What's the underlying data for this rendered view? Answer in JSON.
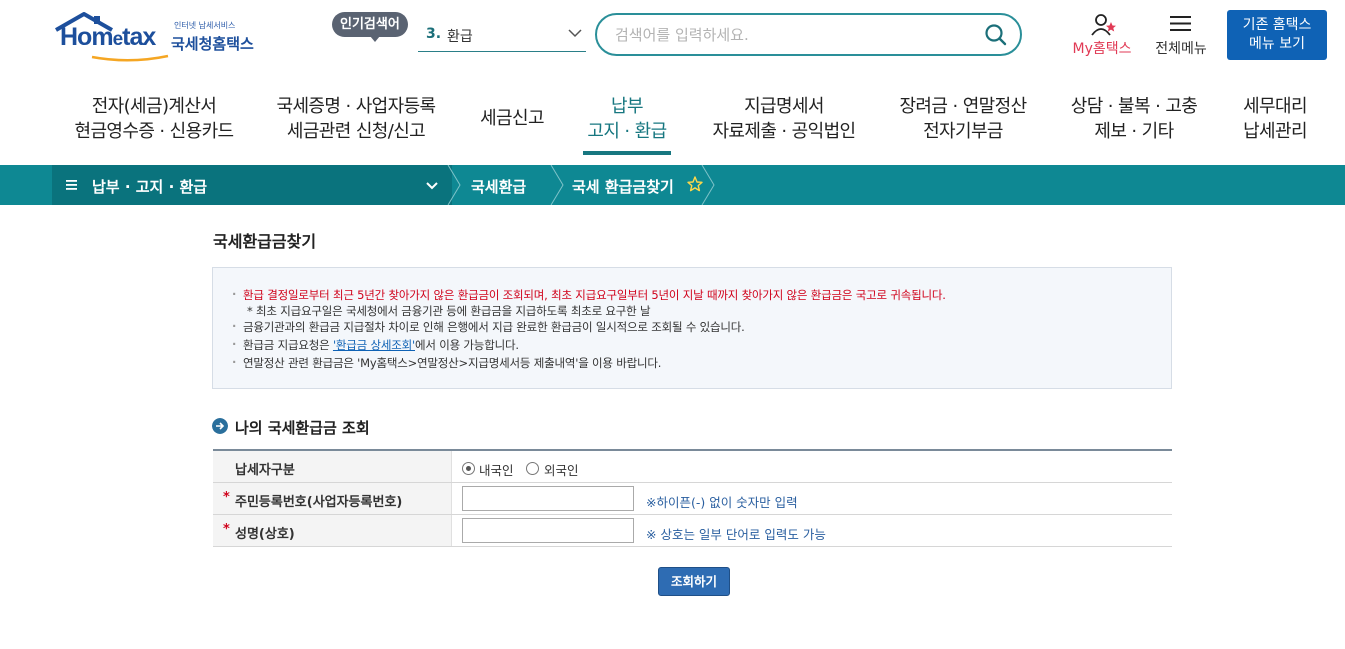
{
  "header": {
    "logo_tagline": "인터넷 납세서비스",
    "logo_brand": "Hometax",
    "logo_brand_prefix": "Hom",
    "logo_brand_e": "e",
    "logo_brand_suffix": "tax",
    "logo_korean_name": "국세청홈택스",
    "popular_label": "인기검색어",
    "popular_rank": "3.",
    "popular_keyword": "환급",
    "search_placeholder": "검색어를 입력하세요.",
    "my_hometax_label": "My홈택스",
    "all_menu_label": "전체메뉴",
    "old_menu_line1": "기존 홈택스",
    "old_menu_line2": "메뉴 보기"
  },
  "gnb": [
    {
      "line1": "전자(세금)계산서",
      "line2": "현금영수증 · 신용카드"
    },
    {
      "line1": "국세증명 · 사업자등록",
      "line2": "세금관련 신청/신고"
    },
    {
      "line1": "세금신고",
      "line2": ""
    },
    {
      "line1": "납부",
      "line2": "고지 · 환급",
      "active": true
    },
    {
      "line1": "지급명세서",
      "line2": "자료제출 · 공익법인"
    },
    {
      "line1": "장려금 · 연말정산",
      "line2": "전자기부금"
    },
    {
      "line1": "상담 · 불복 · 고충",
      "line2": "제보 · 기타"
    },
    {
      "line1": "세무대리",
      "line2": "납세관리"
    }
  ],
  "location": {
    "menu_icon": "hamburger-icon",
    "level1": "납부 · 고지 · 환급",
    "level2": "국세환급",
    "level3": "국세 환급금찾기",
    "favorite_icon": "star-outline-icon"
  },
  "page_title": "국세환급금찾기",
  "notices": {
    "n1": "환급 결정일로부터 최근 5년간 찾아가지 않은 환급금이 조회되며, 최초 지급요구일부터 5년이 지날 때까지 찾아가지 않은 환급금은 국고로 귀속됩니다.",
    "n1_sub": "* 최초 지급요구일은 국세청에서 금융기관 등에 환급금을 지급하도록 최초로 요구한 날",
    "n2": "금융기관과의 환급금 지급절차 차이로 인해 은행에서 지급 완료한 환급금이 일시적으로 조회될 수 있습니다.",
    "n3_before": "환급금 지급요청은 ",
    "n3_link": "'환급금 상세조회'",
    "n3_after": "에서 이용 가능합니다.",
    "n4": "연말정산 관련 환급금은 'My홈택스>연말정산>지급명세서등 제출내역'을 이용 바랍니다."
  },
  "section_title": "나의 국세환급금 조회",
  "form": {
    "row1_label": "납세자구분",
    "option_domestic": "내국인",
    "option_foreign": "외국인",
    "selected_option": "내국인",
    "required_mark": "*",
    "row2_label": "주민등록번호(사업자등록번호)",
    "row2_hint": "※하이픈(-) 없이 숫자만 입력",
    "row3_label": "성명(상호)",
    "row3_hint": "※ 상호는 일부 단어로 입력도 가능",
    "id_value": "",
    "name_value": ""
  },
  "submit_label": "조회하기",
  "colors": {
    "teal": "#0e8893",
    "brand_blue": "#0f62b5",
    "accent_red": "#d0021b",
    "my_pink": "#e13a55"
  }
}
